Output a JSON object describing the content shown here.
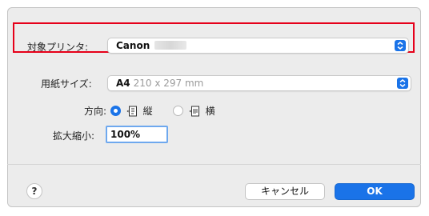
{
  "dialog": {
    "printer": {
      "label": "対象プリンタ:",
      "value": "Canon"
    },
    "paper_size": {
      "label": "用紙サイズ:",
      "value": "A4",
      "detail": "210 x 297 mm"
    },
    "orientation": {
      "label": "方向:",
      "options": [
        {
          "label": "縦",
          "selected": true
        },
        {
          "label": "横",
          "selected": false
        }
      ]
    },
    "scale": {
      "label": "拡大縮小:",
      "value": "100%"
    }
  },
  "footer": {
    "help_label": "?",
    "cancel_label": "キャンセル",
    "ok_label": "OK"
  },
  "colors": {
    "accent": "#1a73e8",
    "highlight_border": "#e6001a"
  },
  "icons": [
    "chevron-updown-icon",
    "portrait-icon",
    "landscape-icon",
    "help-icon"
  ]
}
